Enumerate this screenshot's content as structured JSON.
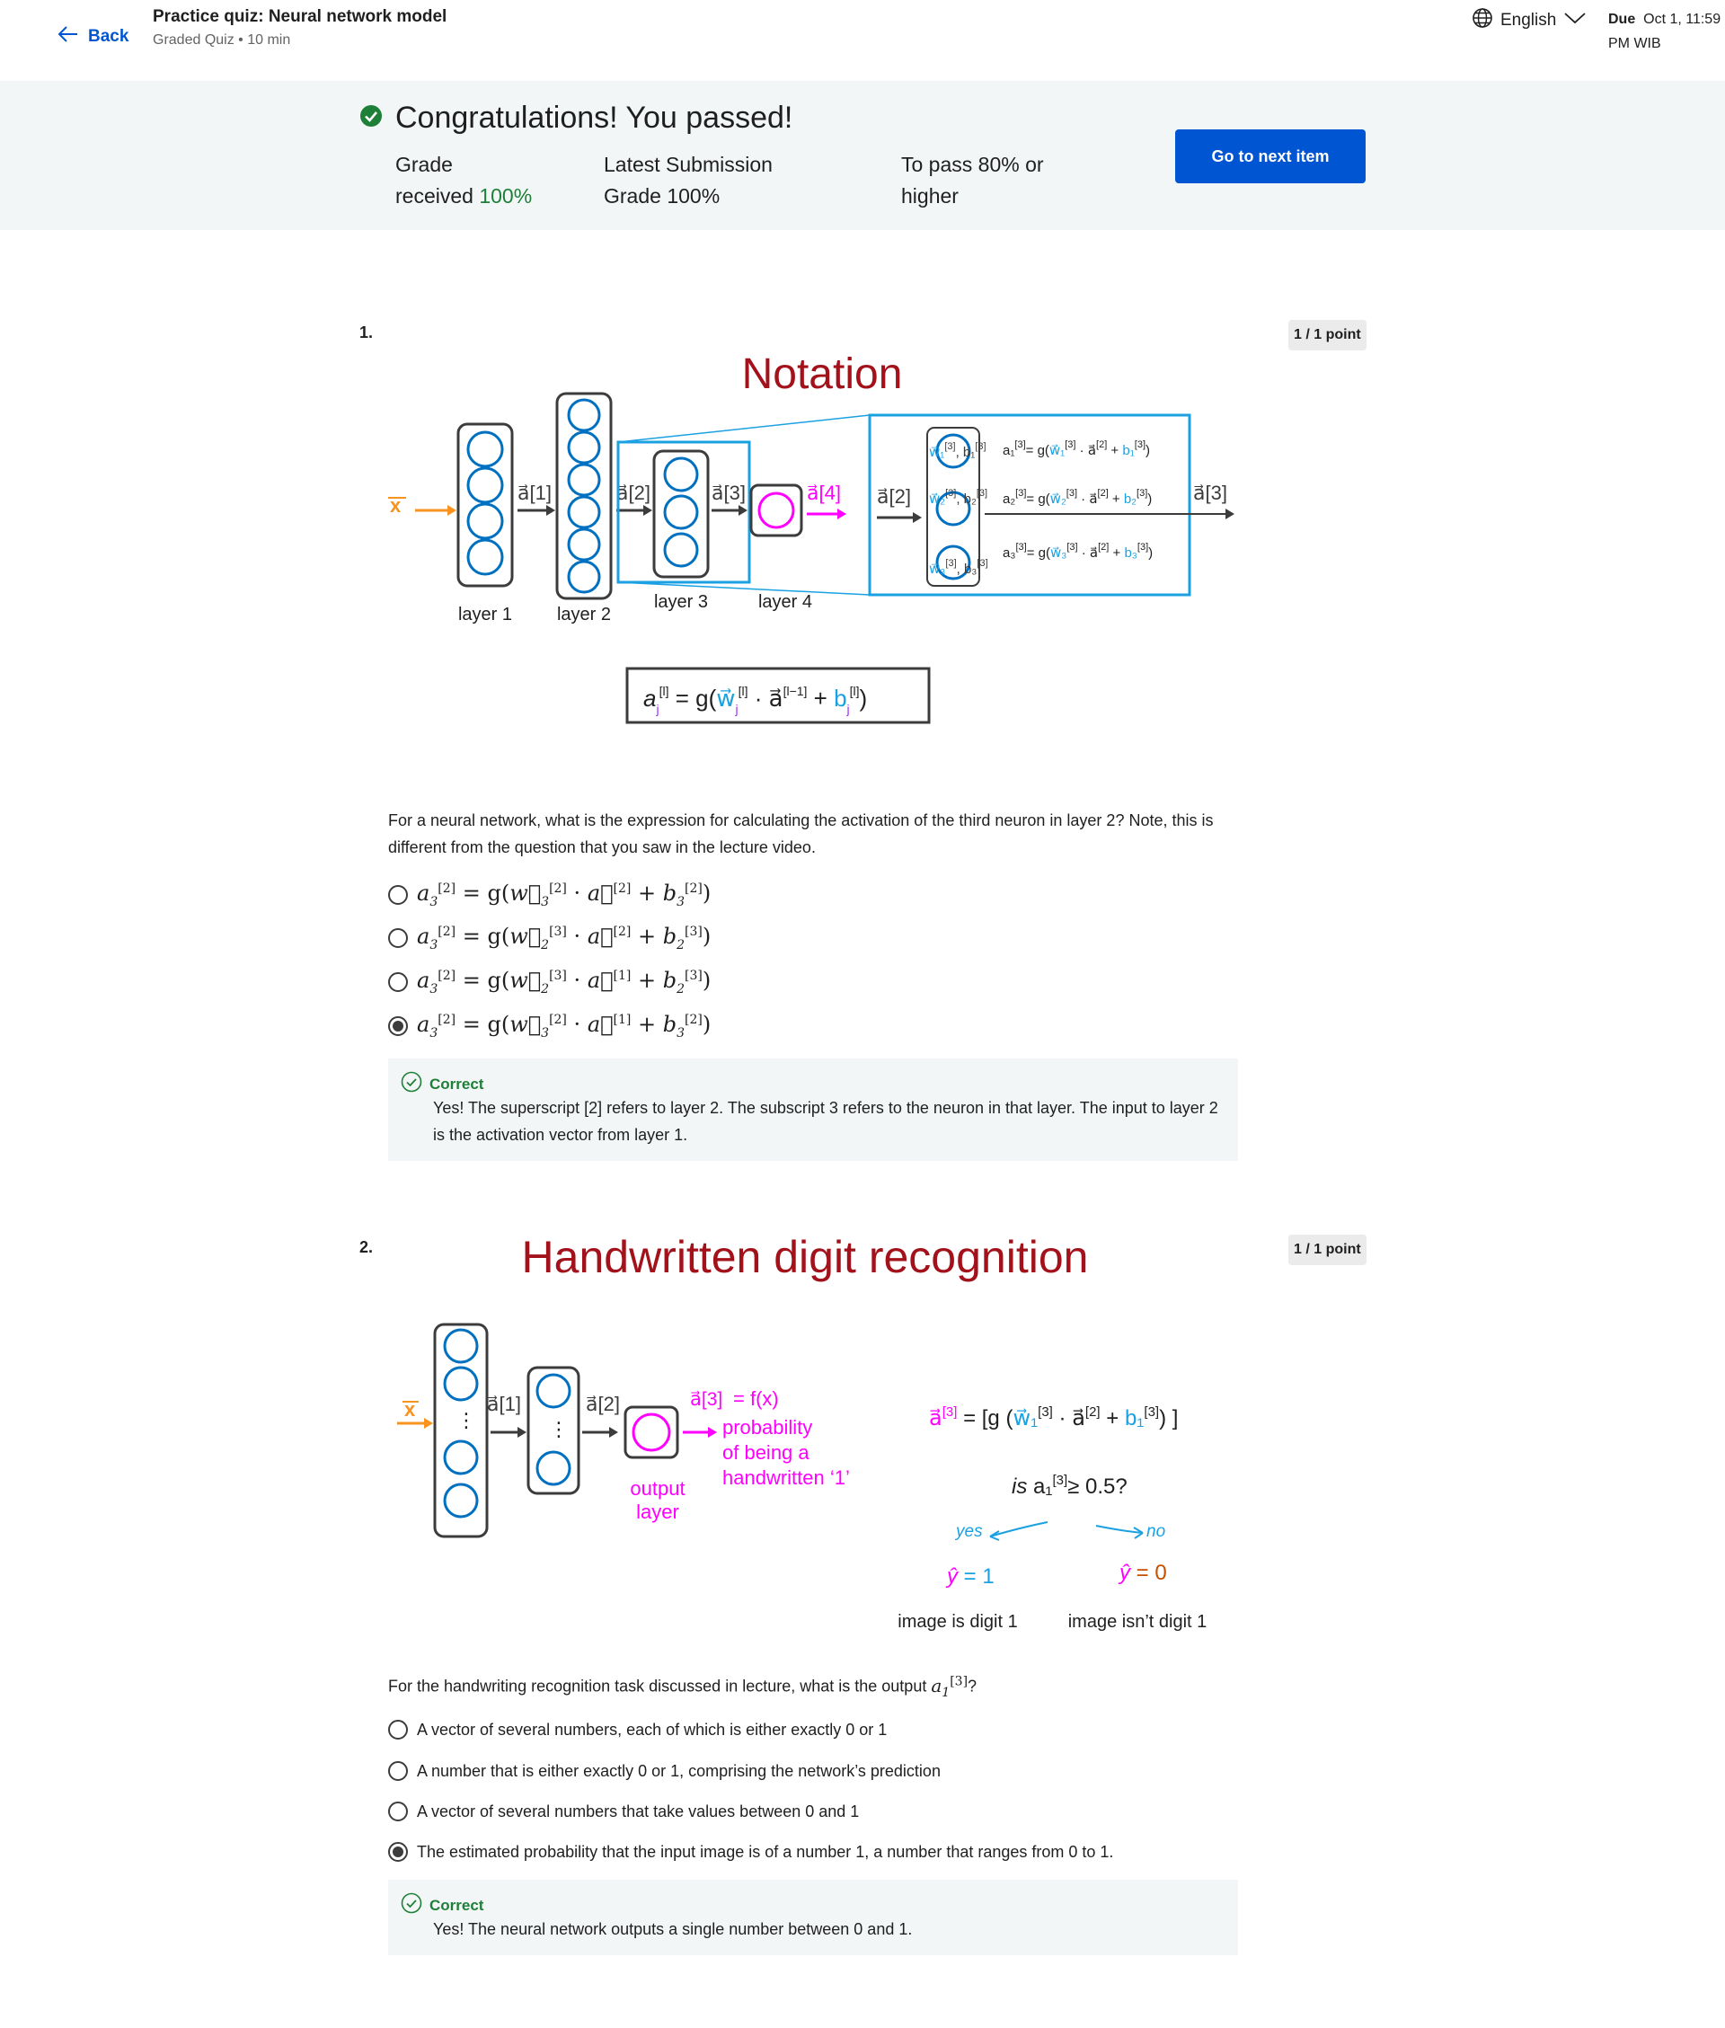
{
  "header": {
    "back_label": "Back",
    "title": "Practice quiz: Neural network model",
    "subtitle": "Graded Quiz • 10 min",
    "language": "English",
    "due_label": "Due",
    "due_value": "Oct 1, 11:59",
    "due_value_2": "PM WIB"
  },
  "banner": {
    "congrats": "Congratulations! You passed!",
    "grade_label_1": "Grade",
    "grade_label_2": "received",
    "grade_value": "100%",
    "latest_label": "Latest Submission",
    "latest_grade_label": "Grade",
    "latest_value": "100%",
    "pass_label": "To pass",
    "pass_value": "80%",
    "pass_suffix": "or",
    "pass_line2": "higher",
    "next_button": "Go to next item"
  },
  "q1": {
    "number": "1.",
    "points": "1 / 1 point",
    "figure_title": "Notation",
    "layer_labels": [
      "layer 1",
      "layer 2",
      "layer 3",
      "layer 4"
    ],
    "prompt": "For a neural network, what is the expression for calculating the activation of the third neuron in layer 2? Note, this is different from the question that you saw in the lecture video.",
    "options": [
      "a3[2] = g(w3[2] · a[2] + b3[2])",
      "a3[2] = g(w2[3] · a[2] + b2[3])",
      "a3[2] = g(w2[3] · a[1] + b2[3])",
      "a3[2] = g(w3[2] · a[1] + b3[2])"
    ],
    "selected_index": 3,
    "feedback_title": "Correct",
    "feedback_text": "Yes! The superscript [2] refers to layer 2. The subscript 3 refers to the neuron in that layer. The input to layer 2 is the activation vector from layer 1."
  },
  "q2": {
    "number": "2.",
    "points": "1 / 1 point",
    "figure_title": "Handwritten digit recognition",
    "output_layer_label": "output layer",
    "probability_text": "probability of being a handwritten ‘1’",
    "is_label": "is",
    "threshold": "≥ 0.5?",
    "yes_label": "yes",
    "no_label": "no",
    "yhat1": "= 1",
    "yhat0": "= 0",
    "image_is": "image is digit 1",
    "image_isnt": "image isn’t digit 1",
    "prompt_text": "For the handwriting recognition task discussed in lecture, what is the output",
    "options": [
      "A vector of several numbers, each of which is either exactly 0 or 1",
      "A number that is either exactly 0 or 1, comprising the network’s prediction",
      "A vector of several numbers that take values between 0 and 1",
      "The estimated probability that the input image is of a number 1, a number that ranges from 0 to 1."
    ],
    "selected_index": 3,
    "feedback_title": "Correct",
    "feedback_text": "Yes! The neural network outputs a single number between 0 and 1."
  },
  "colors": {
    "accent": "#0056d2",
    "success": "#1e8038",
    "figure_title": "#a3121a",
    "magenta": "#ff00ff",
    "orange": "#f7931e",
    "blue_box": "#1ba1e2"
  }
}
